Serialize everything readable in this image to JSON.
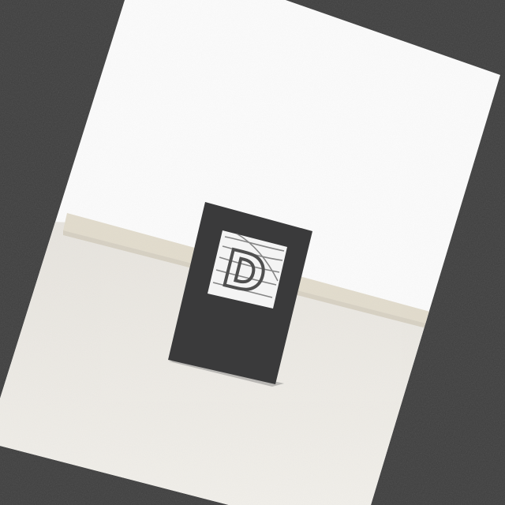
{
  "scene": {
    "description_free": true,
    "sign_letter": "D",
    "colors": {
      "background_noise": "#3d3d3d",
      "wall": "#fbfbfb",
      "floor": "#eeebe5",
      "baseboard": "#e2dccd",
      "sign_frame": "#3a3a3b",
      "sign_window": "#f4f4f4",
      "letter_stroke": "#4f4f4f"
    }
  }
}
